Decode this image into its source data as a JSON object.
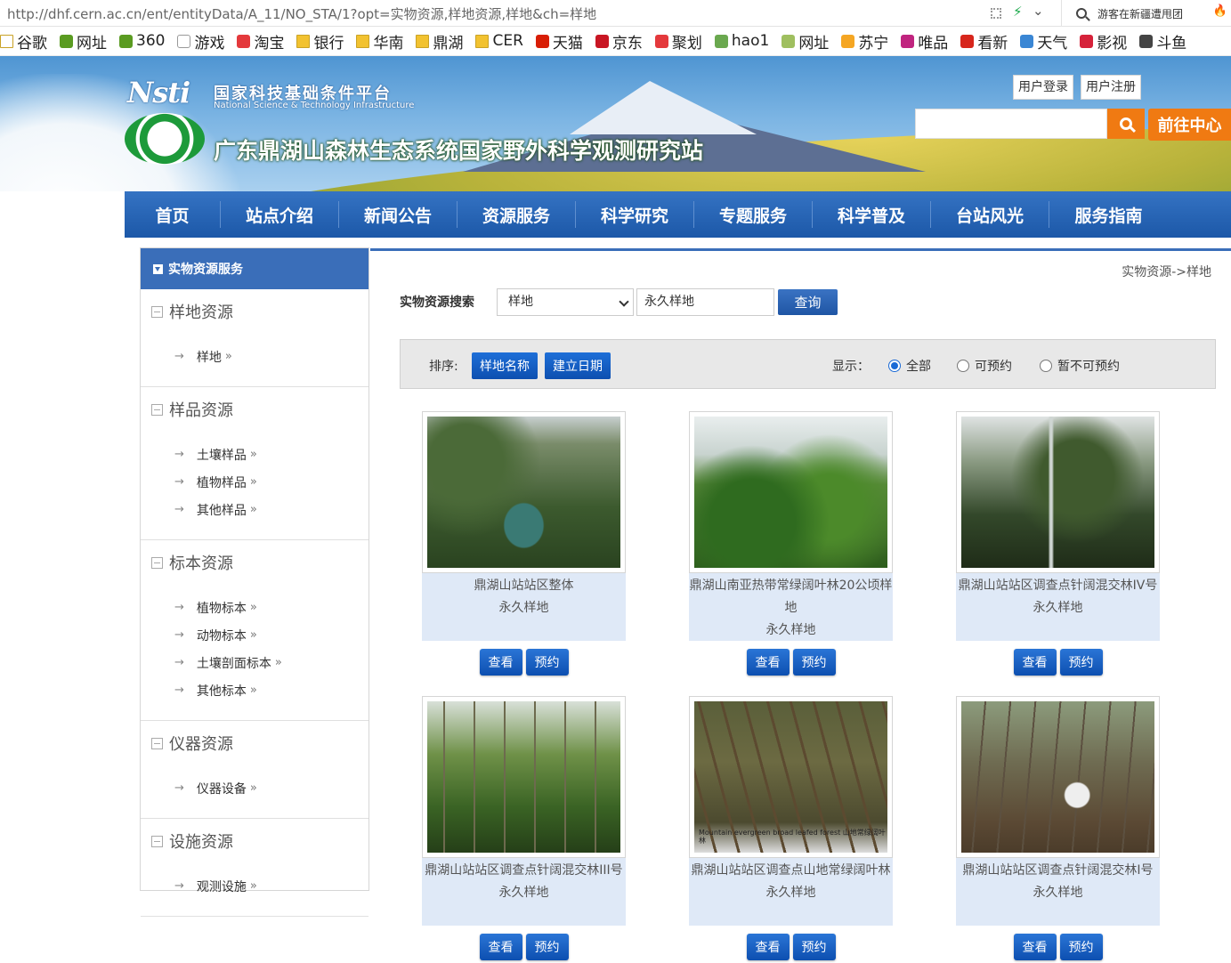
{
  "browser": {
    "url": "http://dhf.cern.ac.cn/ent/entityData/A_11/NO_STA/1?opt=实物资源,样地资源,样地&ch=样地",
    "search_text": "游客在新疆遭甩团",
    "bookmarks": [
      {
        "label": "谷歌",
        "icon": "folder-icon",
        "color": "#ffffff"
      },
      {
        "label": "网址",
        "icon": "globe-icon",
        "color": "#5a9b21"
      },
      {
        "label": "360",
        "icon": "globe-icon",
        "color": "#5a9b21"
      },
      {
        "label": "游戏",
        "icon": "page-icon",
        "color": "#cccccc"
      },
      {
        "label": "淘宝",
        "icon": "taobao-icon",
        "color": "#e4393c"
      },
      {
        "label": "银行",
        "icon": "folder-icon",
        "color": "#f2c230"
      },
      {
        "label": "华南",
        "icon": "folder-icon",
        "color": "#f2c230"
      },
      {
        "label": "鼎湖",
        "icon": "folder-icon",
        "color": "#f2c230"
      },
      {
        "label": "CER",
        "icon": "folder-icon",
        "color": "#f2c230"
      },
      {
        "label": "天猫",
        "icon": "tmall-icon",
        "color": "#d81e06"
      },
      {
        "label": "京东",
        "icon": "jd-icon",
        "color": "#c81623"
      },
      {
        "label": "聚划",
        "icon": "taobao-icon",
        "color": "#e4393c"
      },
      {
        "label": "hao1",
        "icon": "hao-icon",
        "color": "#6aa84f"
      },
      {
        "label": "网址",
        "icon": "7654-icon",
        "color": "#9fbf5f"
      },
      {
        "label": "苏宁",
        "icon": "suning-icon",
        "color": "#f5a623"
      },
      {
        "label": "唯品",
        "icon": "vip-icon",
        "color": "#c0247f"
      },
      {
        "label": "看新",
        "icon": "news-icon",
        "color": "#d7261c"
      },
      {
        "label": "天气",
        "icon": "weather-icon",
        "color": "#3a86d4"
      },
      {
        "label": "影视",
        "icon": "play-icon",
        "color": "#d6223a"
      },
      {
        "label": "斗鱼",
        "icon": "douyu-icon",
        "color": "#444444"
      }
    ]
  },
  "banner": {
    "nsti_logo": "Nsti",
    "nsti_cn": "国家科技基础条件平台",
    "nsti_en": "National Science & Technology Infrastructure",
    "site_title": "广东鼎湖山森林生态系统国家野外科学观测研究站",
    "login_label": "用户登录",
    "register_label": "用户注册",
    "search_placeholder": "",
    "center_label": "前往中心"
  },
  "nav": [
    {
      "label": "首页",
      "w": 108
    },
    {
      "label": "站点介绍",
      "w": 133
    },
    {
      "label": "新闻公告",
      "w": 133
    },
    {
      "label": "资源服务",
      "w": 133
    },
    {
      "label": "科学研究",
      "w": 133
    },
    {
      "label": "专题服务",
      "w": 133
    },
    {
      "label": "科学普及",
      "w": 133
    },
    {
      "label": "台站风光",
      "w": 133
    },
    {
      "label": "服务指南",
      "w": 133
    }
  ],
  "sidebar": {
    "header": "实物资源服务",
    "groups": [
      {
        "title": "样地资源",
        "items": [
          "样地"
        ]
      },
      {
        "title": "样品资源",
        "items": [
          "土壤样品",
          "植物样品",
          "其他样品"
        ]
      },
      {
        "title": "标本资源",
        "items": [
          "植物标本",
          "动物标本",
          "土壤剖面标本",
          "其他标本"
        ]
      },
      {
        "title": "仪器资源",
        "items": [
          "仪器设备"
        ]
      },
      {
        "title": "设施资源",
        "items": [
          "观测设施"
        ]
      }
    ]
  },
  "main": {
    "breadcrumb": "实物资源->样地",
    "search_label": "实物资源搜索",
    "select_value": "样地",
    "input_value": "永久样地",
    "search_button": "查询",
    "sort_label": "排序:",
    "sort_name": "样地名称",
    "sort_date": "建立日期",
    "display_label": "显示：",
    "radios": [
      {
        "label": "全部",
        "checked": true
      },
      {
        "label": "可预约",
        "checked": false
      },
      {
        "label": "暂不可预约",
        "checked": false
      }
    ],
    "cards": [
      {
        "name": "鼎湖山站站区整体",
        "type": "永久样地",
        "view": "查看",
        "reserve": "预约"
      },
      {
        "name": "鼎湖山南亚热带常绿阔叶林20公顷样地",
        "type": "永久样地",
        "view": "查看",
        "reserve": "预约"
      },
      {
        "name": "鼎湖山站站区调查点针阔混交林IV号",
        "type": "永久样地",
        "view": "查看",
        "reserve": "预约"
      },
      {
        "name": "鼎湖山站站区调查点针阔混交林III号",
        "type": "永久样地",
        "view": "查看",
        "reserve": "预约"
      },
      {
        "name": "鼎湖山站站区调查点山地常绿阔叶林",
        "type": "永久样地",
        "view": "查看",
        "reserve": "预约",
        "photo_caption": "Mountain evergreen  broad leafed forest  山地常绿阔叶林"
      },
      {
        "name": "鼎湖山站站区调查点针阔混交林I号",
        "type": "永久样地",
        "view": "查看",
        "reserve": "预约"
      }
    ]
  }
}
